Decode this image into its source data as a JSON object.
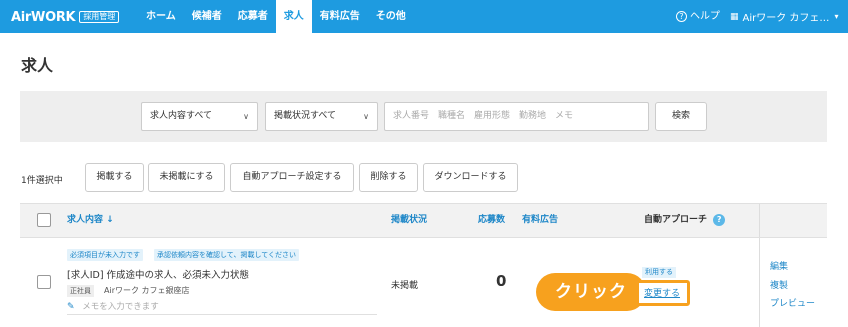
{
  "header": {
    "logo_text": "AirWORK",
    "logo_badge": "採用管理",
    "nav": [
      "ホーム",
      "候補者",
      "応募者",
      "求人",
      "有料広告",
      "その他"
    ],
    "active_nav": "求人",
    "help_label": "ヘルプ",
    "account_label": "Airワーク カフェ…",
    "icons": {
      "help": "question-circle-icon",
      "account": "building-icon",
      "chevron": "chevron-down-icon"
    },
    "colors": {
      "header_bg": "#1e9be0"
    }
  },
  "page": {
    "title": "求人"
  },
  "filters": {
    "content_select": "求人内容すべて",
    "status_select": "掲載状況すべて",
    "search_placeholder": "求人番号　職種名　雇用形態　勤務地　メモ",
    "search_button": "検索"
  },
  "actions": {
    "selected_count": "1件選択中",
    "publish": "掲載する",
    "unpublish": "未掲載にする",
    "auto_approach": "自動アプローチ設定する",
    "delete": "削除する",
    "download": "ダウンロードする"
  },
  "table": {
    "headers": {
      "content": "求人内容",
      "content_sort_icon": "arrow-down-icon",
      "status": "掲載状況",
      "applicants": "応募数",
      "paid_ads": "有料広告",
      "auto_approach": "自動アプローチ"
    },
    "rows": [
      {
        "tag_required": "必須項目が未入力です",
        "tag_approval": "承認依頼内容を確認して、掲載してください",
        "title": "[求人ID] 作成途中の求人、必須未入力状態",
        "employment_type": "正社員",
        "store": "Airワーク カフェ銀座店",
        "memo_placeholder": "メモを入力できます",
        "status": "未掲載",
        "applicants": "0",
        "auto_approach_badge": "利用する",
        "auto_approach_link": "変更する",
        "links": [
          "編集",
          "複製",
          "プレビュー"
        ]
      }
    ]
  },
  "callout": {
    "label": "クリック",
    "color": "#f7a11e"
  }
}
